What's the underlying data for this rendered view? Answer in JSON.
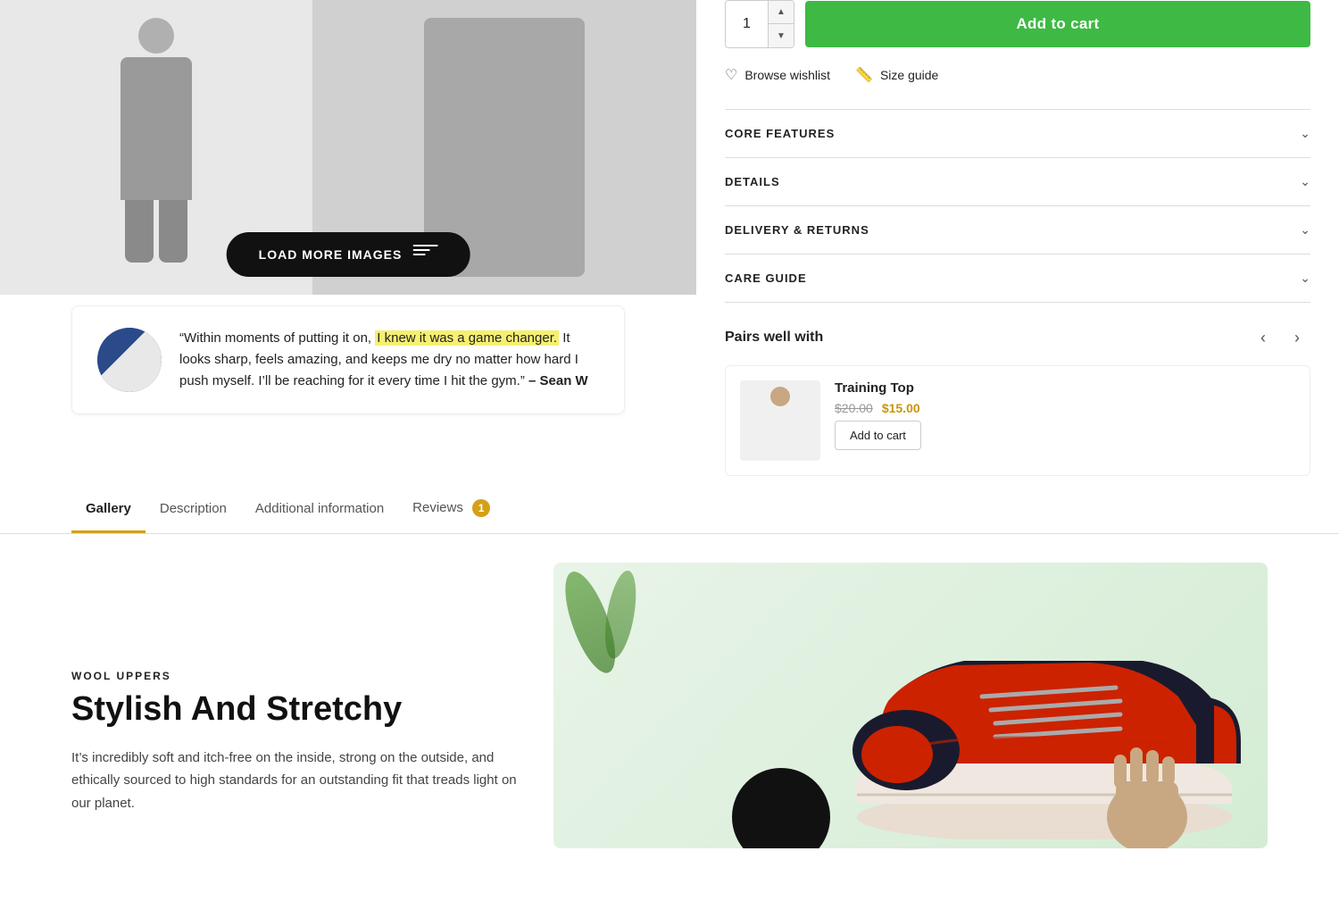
{
  "product": {
    "images": {
      "load_more_label": "LOAD MORE IMAGES"
    },
    "review": {
      "quote_before": "“Within moments of putting it on,",
      "quote_highlight": "I knew it was a game changer.",
      "quote_after": " It looks sharp, feels amazing, and keeps me dry no matter how hard I push myself. I’ll be reaching for it every time I hit the gym.”",
      "author_label": "– Sean W"
    }
  },
  "cart": {
    "quantity": "1",
    "add_to_cart_label": "Add to cart",
    "browse_wishlist_label": "Browse wishlist",
    "size_guide_label": "Size guide"
  },
  "accordion": {
    "items": [
      {
        "id": "core-features",
        "label": "CORE FEATURES"
      },
      {
        "id": "details",
        "label": "DETAILS"
      },
      {
        "id": "delivery-returns",
        "label": "DELIVERY & RETURNS"
      },
      {
        "id": "care-guide",
        "label": "CARE GUIDE"
      }
    ]
  },
  "pairs": {
    "title": "Pairs well with",
    "product_name": "Training Top",
    "old_price": "$20.00",
    "new_price": "$15.00",
    "add_label": "Add to cart"
  },
  "tabs": {
    "items": [
      {
        "id": "gallery",
        "label": "Gallery",
        "active": true
      },
      {
        "id": "description",
        "label": "Description",
        "active": false
      },
      {
        "id": "additional-information",
        "label": "Additional information",
        "active": false
      },
      {
        "id": "reviews",
        "label": "Reviews",
        "active": false,
        "badge": "1"
      }
    ]
  },
  "gallery": {
    "wool_label": "WOOL UPPERS",
    "heading": "Stylish And Stretchy",
    "description": "It’s incredibly soft and itch-free on the inside, strong on the outside, and ethically sourced to high standards for an outstanding fit that treads light on our planet."
  }
}
